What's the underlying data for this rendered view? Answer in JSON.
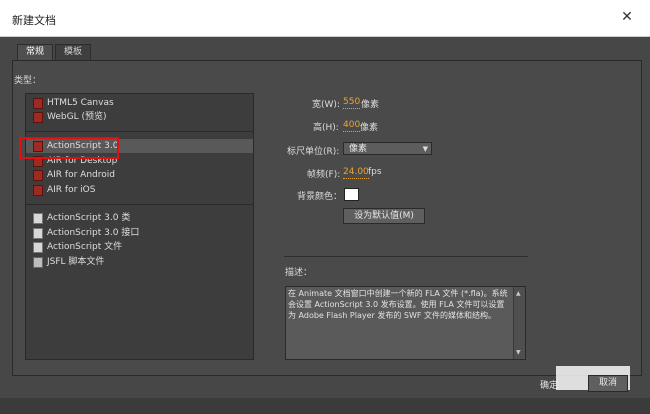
{
  "window": {
    "title": "新建文档",
    "close_glyph": "✕"
  },
  "tabs": [
    {
      "label": "常规",
      "active": true
    },
    {
      "label": "模板",
      "active": false
    }
  ],
  "type_label": "类型：",
  "type_groups": [
    {
      "items": [
        {
          "label": "HTML5 Canvas",
          "icon": "animate-doc-icon"
        },
        {
          "label": "WebGL (预览)",
          "icon": "animate-doc-icon"
        }
      ]
    },
    {
      "items": [
        {
          "label": "ActionScript 3.0",
          "icon": "animate-doc-icon",
          "selected": true
        },
        {
          "label": "AIR for Desktop",
          "icon": "animate-doc-icon"
        },
        {
          "label": "AIR for Android",
          "icon": "animate-doc-icon"
        },
        {
          "label": "AIR for iOS",
          "icon": "animate-doc-icon"
        }
      ]
    },
    {
      "items": [
        {
          "label": "ActionScript 3.0 类",
          "icon": "script-file-icon"
        },
        {
          "label": "ActionScript 3.0 接口",
          "icon": "script-file-icon"
        },
        {
          "label": "ActionScript 文件",
          "icon": "script-file-icon"
        },
        {
          "label": "JSFL 脚本文件",
          "icon": "jsfl-file-icon"
        }
      ]
    }
  ],
  "settings": {
    "width_label": "宽(W):",
    "width_value": "550",
    "width_unit": "像素",
    "height_label": "高(H):",
    "height_value": "400",
    "height_unit": "像素",
    "ruler_label": "标尺单位(R):",
    "ruler_value": "像素",
    "fps_label": "帧频(F):",
    "fps_value": "24.00",
    "fps_unit": "fps",
    "bg_label": "背景颜色：",
    "bg_color": "#ffffff",
    "default_button": "设为默认值(M)"
  },
  "description": {
    "label": "描述：",
    "text": "在 Animate 文档窗口中创建一个新的 FLA 文件 (*.fla)。系统会设置 ActionScript 3.0 发布设置。使用 FLA 文件可以设置为 Adobe Flash Player 发布的 SWF 文件的媒体和结构。"
  },
  "footer": {
    "ok_label": "确定",
    "cancel_label": "取消"
  },
  "colors": {
    "accent_value": "#e8a533",
    "highlight_box": "#e01010"
  }
}
